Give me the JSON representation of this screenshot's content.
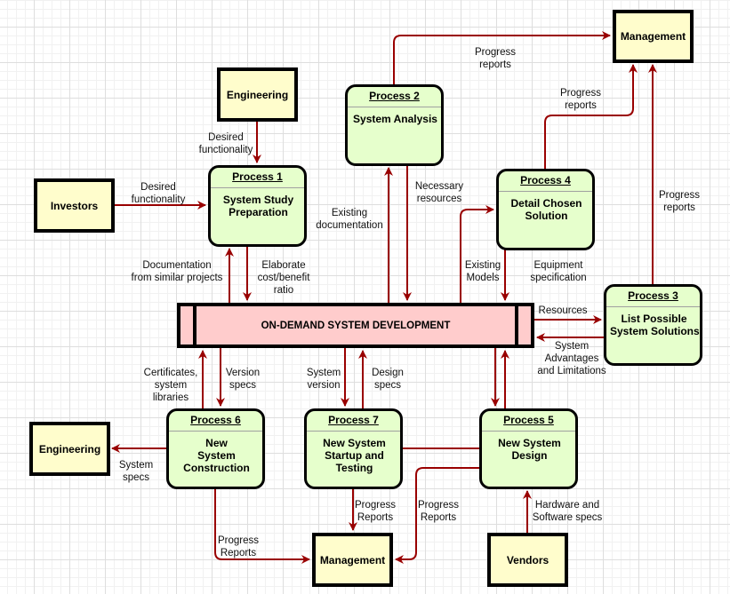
{
  "diagram": {
    "type": "data-flow-diagram",
    "colors": {
      "flow": "#990000",
      "entity_fill": "#fffdcc",
      "process_fill": "#e6ffcc",
      "store_fill": "#ffcccc",
      "border": "#000000"
    },
    "store": {
      "label": "ON-DEMAND SYSTEM DEVELOPMENT"
    },
    "entities": {
      "management_top": "Management",
      "engineering_top": "Engineering",
      "investors": "Investors",
      "engineering_bottom": "Engineering",
      "management_bottom": "Management",
      "vendors": "Vendors"
    },
    "processes": {
      "p1": {
        "title": "Process 1",
        "name": "System Study\nPreparation"
      },
      "p2": {
        "title": "Process 2",
        "name": "System Analysis"
      },
      "p3": {
        "title": "Process 3",
        "name": "List Possible\nSystem Solutions"
      },
      "p4": {
        "title": "Process 4",
        "name": "Detail Chosen\nSolution"
      },
      "p5": {
        "title": "Process 5",
        "name": "New System\nDesign"
      },
      "p6": {
        "title": "Process 6",
        "name": "New\nSystem\nConstruction"
      },
      "p7": {
        "title": "Process 7",
        "name": "New System\nStartup and\nTesting"
      }
    },
    "flows": {
      "p2_to_mgmt": "Progress\nreports",
      "p4_to_mgmt": "Progress\nreports",
      "p3_to_mgmt": "Progress\nreports",
      "eng_to_p1": "Desired\nfunctionality",
      "inv_to_p1": "Desired\nfunctionality",
      "store_to_p2": "Existing\ndocumentation",
      "p2_to_store": "Necessary\nresources",
      "store_to_p1": "Documentation\nfrom similar projects",
      "p1_to_store": "Elaborate\ncost/benefit\nratio",
      "store_to_p4": "Existing\nModels",
      "p4_to_store": "Equipment\nspecification",
      "store_to_p3": "Resources",
      "p3_to_store": "System\nAdvantages\nand Limitations",
      "p6_to_store": "Certificates,\nsystem\nlibraries",
      "store_to_p6": "Version\nspecs",
      "store_to_p7": "System\nversion",
      "p7_to_store": "Design\nspecs",
      "p6_to_eng": "System\nspecs",
      "p6_to_mgmt": "Progress\nReports",
      "p7_to_mgmt": "Progress\nReports",
      "p5_to_mgmt": "Progress\nReports",
      "vendors_to_p5": "Hardware and\nSoftware specs"
    }
  }
}
